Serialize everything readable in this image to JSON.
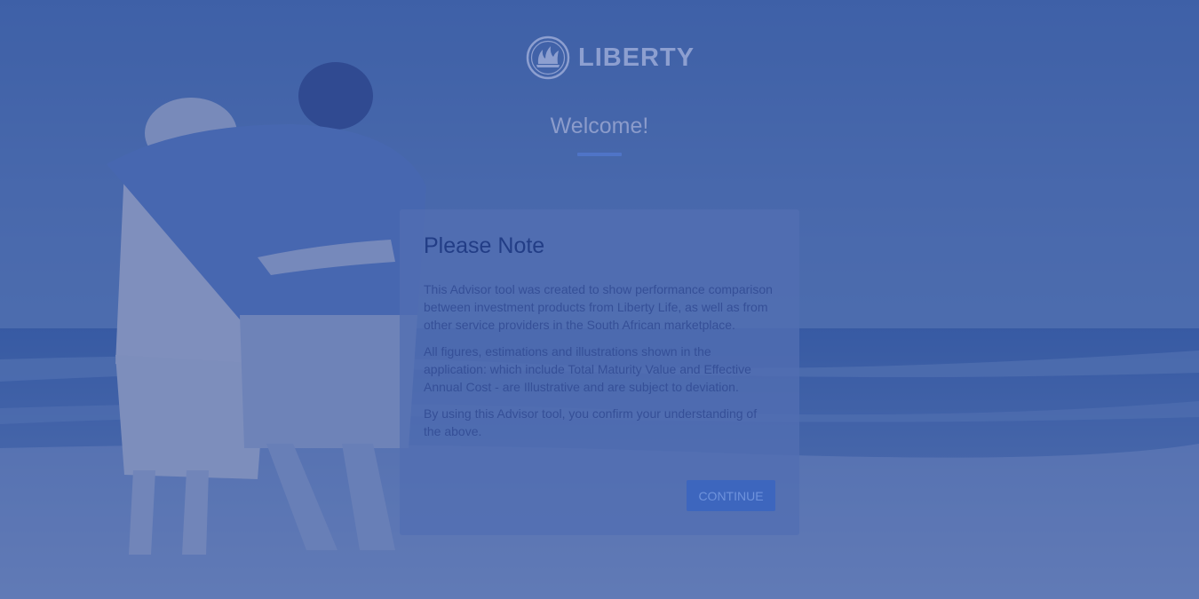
{
  "brand": {
    "name": "LIBERTY",
    "logo_icon": "liberty-flame-logo-icon"
  },
  "header": {
    "welcome": "Welcome!"
  },
  "modal": {
    "title": "Please Note",
    "paragraphs": [
      "This Advisor tool was created to show performance comparison between investment products from Liberty Life, as well as from other service providers in the South African marketplace.",
      "All figures, estimations and illustrations shown in the application: which include Total Maturity Value and Effective Annual Cost - are Illustrative and are subject to deviation.",
      "By using this Advisor tool, you confirm your understanding of the above."
    ],
    "continue_label": "CONTINUE"
  },
  "colors": {
    "overlay": "#28428c",
    "accent": "#4f74c7",
    "button": "#3d66be",
    "title": "#223d86"
  }
}
